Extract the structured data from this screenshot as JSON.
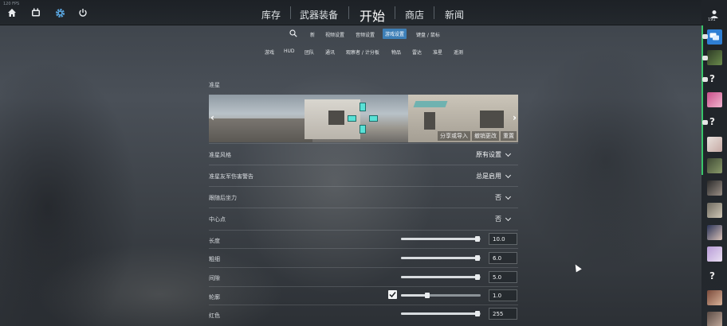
{
  "topbar": {
    "fps": "120 FPS",
    "nav": [
      "库存",
      "武器装备",
      "开始",
      "商店",
      "新闻"
    ]
  },
  "submenu1": [
    "新",
    "视频设置",
    "音频设置",
    "游戏设置",
    "键盘 / 鼠标"
  ],
  "submenu2": [
    "游戏",
    "HUD",
    "团队",
    "通讯",
    "观察者 / 计分板",
    "物品",
    "雷达",
    "准星",
    "遥测"
  ],
  "crosshair": {
    "section_title": "准星",
    "preview_actions": [
      "分享或导入",
      "撤销更改",
      "重置"
    ],
    "rows": {
      "style": {
        "label": "准星风格",
        "value": "原有设置"
      },
      "friendly_warning": {
        "label": "准星友军伤害警告",
        "value": "总是启用"
      },
      "follow_recoil": {
        "label": "跟随后坐力",
        "value": "否"
      },
      "center_dot": {
        "label": "中心点",
        "value": "否"
      }
    },
    "sliders": {
      "length": {
        "label": "长度",
        "value": "10.0",
        "fraction": 0.96
      },
      "thickness": {
        "label": "粗细",
        "value": "6.0",
        "fraction": 0.96
      },
      "gap": {
        "label": "间隙",
        "value": "5.0",
        "fraction": 0.96
      },
      "outline": {
        "label": "轮廓",
        "value": "1.0",
        "fraction": 0.33,
        "checked": true
      },
      "red": {
        "label": "红色",
        "value": "255",
        "fraction": 0.96
      }
    }
  },
  "sidebar": {
    "count": "191"
  },
  "colors": {
    "accent": "#3d7fb7",
    "crosshair": "#59e1d6",
    "online": "#38c66a"
  }
}
